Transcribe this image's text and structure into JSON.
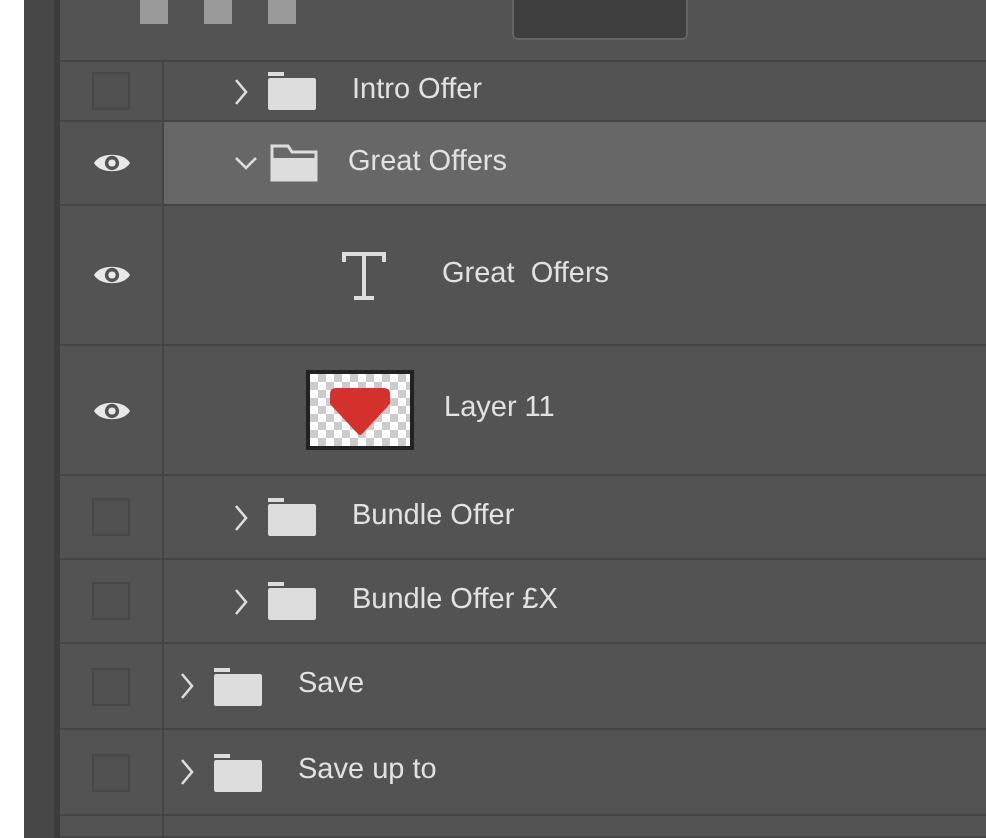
{
  "layers": [
    {
      "kind": "continued",
      "children": [
        {
          "kind": "group",
          "name": "Intro Offer",
          "visible": false,
          "expanded": false,
          "selected": false
        },
        {
          "kind": "group",
          "name": "Great Offers",
          "visible": true,
          "expanded": true,
          "selected": true,
          "children": [
            {
              "kind": "text",
              "name": "Great  Offers",
              "visible": true,
              "selected": false
            },
            {
              "kind": "pixel",
              "name": "Layer 11",
              "visible": true,
              "selected": false
            }
          ]
        },
        {
          "kind": "group",
          "name": "Bundle Offer",
          "visible": false,
          "expanded": false,
          "selected": false
        },
        {
          "kind": "group",
          "name": "Bundle Offer £X",
          "visible": false,
          "expanded": false,
          "selected": false
        }
      ]
    },
    {
      "kind": "group",
      "name": "Save",
      "visible": false,
      "expanded": false,
      "selected": false
    },
    {
      "kind": "group",
      "name": "Save up to",
      "visible": false,
      "expanded": false,
      "selected": false
    }
  ]
}
